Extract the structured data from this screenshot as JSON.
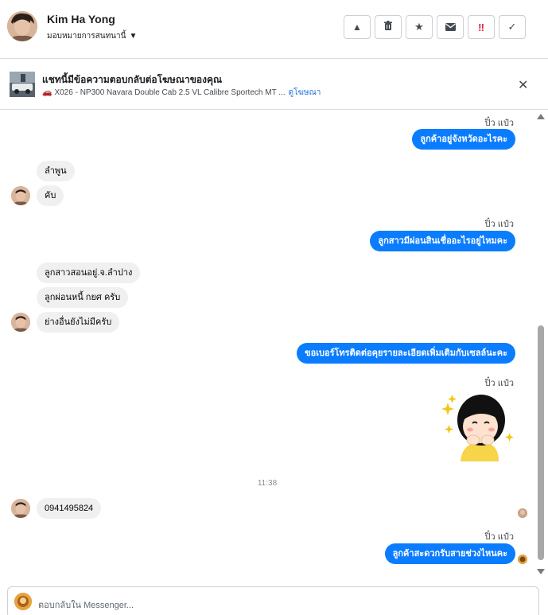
{
  "header": {
    "contact_name": "Kim Ha Yong",
    "assign_label": "มอบหมายการสนทนานี้",
    "actions": [
      {
        "icon": "warning-icon",
        "glyph": "▲"
      },
      {
        "icon": "trash-icon",
        "glyph": "🗑"
      },
      {
        "icon": "star-icon",
        "glyph": "★"
      },
      {
        "icon": "envelope-icon",
        "glyph": "✉"
      },
      {
        "icon": "double-exclamation-icon",
        "glyph": "‼"
      },
      {
        "icon": "check-icon",
        "glyph": "✓"
      }
    ]
  },
  "ad_banner": {
    "title": "แชทนี้มีข้อความตอบกลับต่อโฆษณาของคุณ",
    "car_glyph": "🚗",
    "subtitle": "X026 - NP300 Navara Double Cab 2.5 VL Calibre Sportech MT ...",
    "link": "ดูโฆษณา",
    "close_glyph": "✕"
  },
  "thread": {
    "messages": [
      {
        "dir": "label",
        "text": "ปิ๋ว แป๋ว"
      },
      {
        "dir": "out",
        "text": "ลูกค้าอยู่จังหวัดอะไรคะ"
      },
      {
        "dir": "in",
        "text": "ลำพูน"
      },
      {
        "dir": "in",
        "text": "คับ"
      },
      {
        "dir": "label",
        "text": "ปิ๋ว แป๋ว"
      },
      {
        "dir": "out",
        "text": "ลูกสาวมีผ่อนสินเชื่ออะไรอยู่ไหมคะ"
      },
      {
        "dir": "in",
        "text": "ลูกสาวสอนอยู่.จ.ลำปาง"
      },
      {
        "dir": "in",
        "text": "ลูกผ่อนหนี้ กยศ ครับ"
      },
      {
        "dir": "in",
        "text": "ย่างอื่นยังไม่มีครับ"
      },
      {
        "dir": "out",
        "text": "ขอเบอร์โทรติดต่อคุยรายละเอียดเพิ่มเติมกับเซลล์นะคะ"
      },
      {
        "dir": "label",
        "text": "ปิ๋ว แป๋ว"
      },
      {
        "dir": "time",
        "text": "11:38"
      },
      {
        "dir": "in",
        "text": "0941495824"
      },
      {
        "dir": "label",
        "text": "ปิ๋ว แป๋ว"
      },
      {
        "dir": "out",
        "text": "ลูกค้าสะดวกรับสายช่วงไหนคะ"
      }
    ]
  },
  "composer": {
    "placeholder": "ตอบกลับใน Messenger..."
  },
  "colors": {
    "accent": "#0a7cff",
    "incoming_bubble": "#f0f0f0"
  }
}
